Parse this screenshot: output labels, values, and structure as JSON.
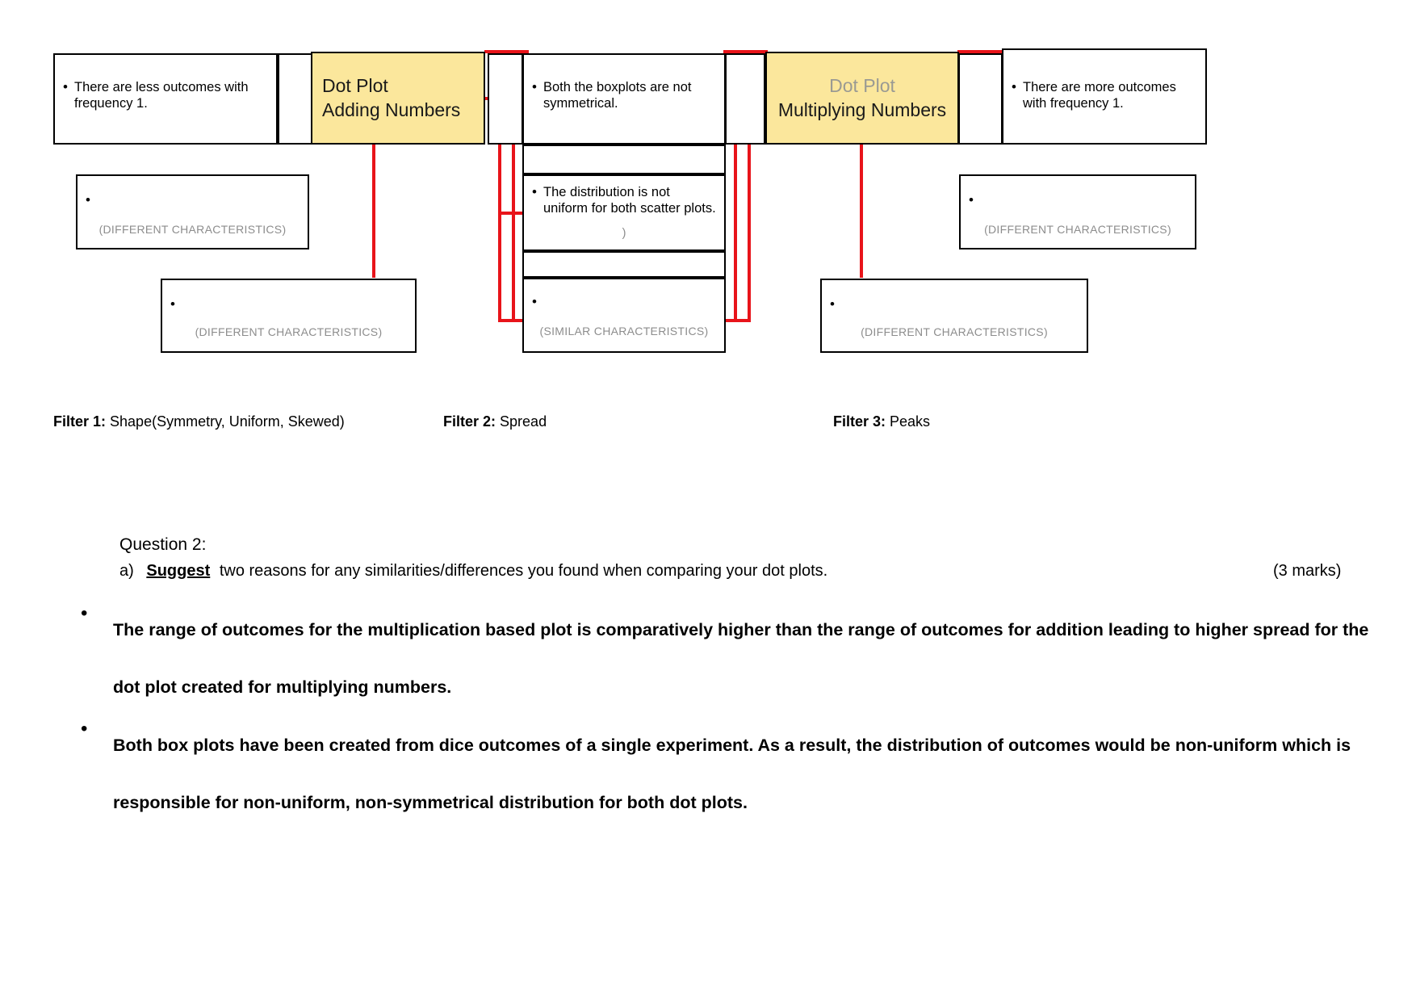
{
  "diagram": {
    "nodes": [
      {
        "id": "dot-plot-adding",
        "line1": "Dot Plot",
        "line2": "Adding Numbers"
      },
      {
        "id": "dot-plot-multiplying",
        "line1": "Dot Plot",
        "line2": "Multiplying Numbers"
      }
    ],
    "statements": [
      {
        "id": "left-top",
        "text": "There are less outcomes with frequency 1."
      },
      {
        "id": "middle-top",
        "text": "Both the boxplots are not symmetrical."
      },
      {
        "id": "middle-mid",
        "text": "The distribution is not uniform for both scatter plots."
      },
      {
        "id": "right-top",
        "text": "There are more outcomes with frequency 1."
      }
    ],
    "placeholders": {
      "different": "(DIFFERENT CHARACTERISTICS)",
      "similar": "(SIMILAR CHARACTERISTICS)",
      "stray_paren": ")"
    },
    "filters": [
      {
        "label": "Filter 1:",
        "value": "Shape(Symmetry, Uniform, Skewed)"
      },
      {
        "label": "Filter 2:",
        "value": "Spread"
      },
      {
        "label": "Filter 3:",
        "value": "Peaks"
      }
    ],
    "colors": {
      "node_fill": "#fbe79c",
      "connector": "#e8141a",
      "border": "#000000",
      "placeholder_text": "#8d8d8d"
    }
  },
  "question": {
    "title": "Question 2:",
    "part_letter": "a)",
    "prompt_emphasis": "Suggest",
    "prompt_rest": "two reasons for any similarities/differences you found when comparing your dot plots.",
    "marks": "(3 marks)"
  },
  "answers": [
    {
      "bullet": "•",
      "line1": "The range of outcomes for the multiplication based plot is comparatively higher than the range of outcomes for addition",
      "line2": "leading to higher spread for the dot plot created for multiplying numbers."
    },
    {
      "bullet": "•",
      "line1": "Both box plots have been created from dice outcomes of a single experiment. As a result, the distribution of outcomes would",
      "line2": "be non-uniform which is responsible for non-uniform, non-symmetrical distribution for both dot plots."
    }
  ]
}
